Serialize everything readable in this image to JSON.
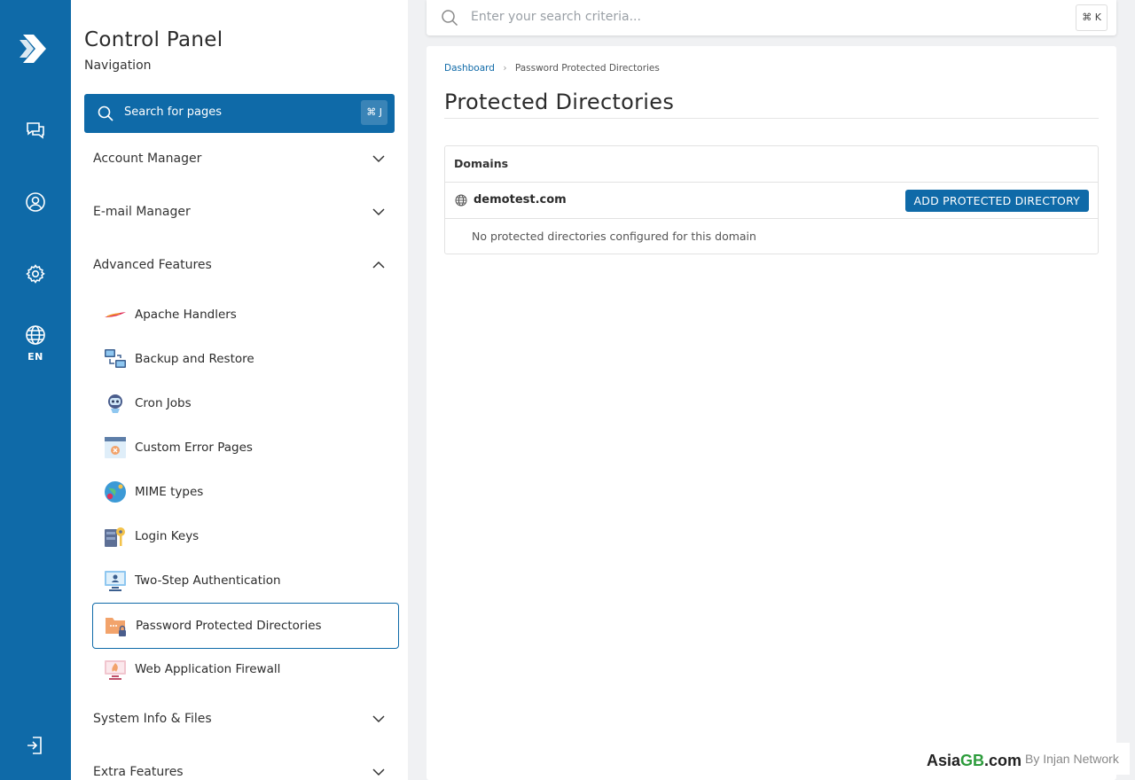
{
  "rail": {
    "language": "EN"
  },
  "nav": {
    "title": "Control Panel",
    "subtitle": "Navigation",
    "search_placeholder": "Search for pages",
    "search_shortcut": "⌘ J",
    "sections": [
      {
        "label": "Account Manager",
        "expanded": false
      },
      {
        "label": "E-mail Manager",
        "expanded": false
      },
      {
        "label": "Advanced Features",
        "expanded": true
      },
      {
        "label": "System Info & Files",
        "expanded": false
      },
      {
        "label": "Extra Features",
        "expanded": false
      }
    ],
    "advanced_items": [
      {
        "label": "Apache Handlers",
        "icon": "feather-icon"
      },
      {
        "label": "Backup and Restore",
        "icon": "backup-monitors-icon"
      },
      {
        "label": "Cron Jobs",
        "icon": "robot-icon"
      },
      {
        "label": "Custom Error Pages",
        "icon": "error-page-icon"
      },
      {
        "label": "MIME types",
        "icon": "globe-mime-icon"
      },
      {
        "label": "Login Keys",
        "icon": "key-icon"
      },
      {
        "label": "Two-Step Authentication",
        "icon": "user-screen-icon"
      },
      {
        "label": "Password Protected Directories",
        "icon": "locked-folder-icon",
        "active": true
      },
      {
        "label": "Web Application Firewall",
        "icon": "firewall-icon"
      }
    ]
  },
  "topbar": {
    "search_placeholder": "Enter your search criteria...",
    "search_shortcut": "⌘ K"
  },
  "main": {
    "breadcrumb": [
      "Dashboard",
      "Password Protected Directories"
    ],
    "title": "Protected Directories",
    "table": {
      "header": "Domains",
      "domain": "demotest.com",
      "add_button": "ADD PROTECTED DIRECTORY",
      "empty_message": "No protected directories configured for this domain"
    }
  },
  "watermark": {
    "brand_prefix": "Asia",
    "brand_highlight": "GB",
    "brand_suffix": ".com",
    "tagline": "By Injan Network"
  },
  "colors": {
    "brand_blue": "#0f6aa8",
    "watermark_green": "#2d9c3c"
  }
}
